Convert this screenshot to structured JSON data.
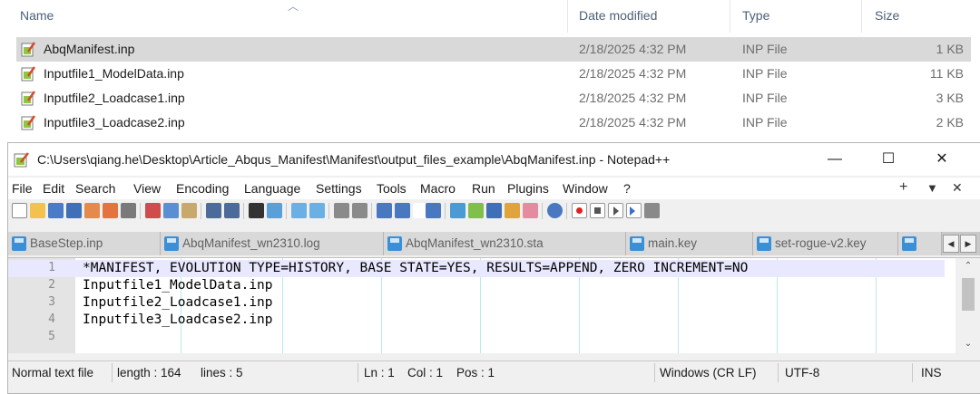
{
  "explorer": {
    "columns": {
      "name": "Name",
      "date": "Date modified",
      "type": "Type",
      "size": "Size"
    },
    "files": [
      {
        "name": "AbqManifest.inp",
        "date": "2/18/2025 4:32 PM",
        "type": "INP File",
        "size": "1 KB",
        "selected": true
      },
      {
        "name": "Inputfile1_ModelData.inp",
        "date": "2/18/2025 4:32 PM",
        "type": "INP File",
        "size": "11 KB",
        "selected": false
      },
      {
        "name": "Inputfile2_Loadcase1.inp",
        "date": "2/18/2025 4:32 PM",
        "type": "INP File",
        "size": "3 KB",
        "selected": false
      },
      {
        "name": "Inputfile3_Loadcase2.inp",
        "date": "2/18/2025 4:32 PM",
        "type": "INP File",
        "size": "2 KB",
        "selected": false
      }
    ]
  },
  "notepad": {
    "title": "C:\\Users\\qiang.he\\Desktop\\Article_Abqus_Manifest\\Manifest\\output_files_example\\AbqManifest.inp - Notepad++",
    "window_buttons": {
      "minimize": "—",
      "maximize": "☐",
      "close": "✕"
    },
    "menu": [
      "File",
      "Edit",
      "Search",
      "View",
      "Encoding",
      "Language",
      "Settings",
      "Tools",
      "Macro",
      "Run",
      "Plugins",
      "Window",
      "?"
    ],
    "menu_right": {
      "plus": "+",
      "down": "▼",
      "close": "✕"
    },
    "tabs": [
      "BaseStep.inp",
      "AbqManifest_wn2310.log",
      "AbqManifest_wn2310.sta",
      "main.key",
      "set-rogue-v2.key"
    ],
    "lines": [
      {
        "num": "1",
        "text": "*MANIFEST, EVOLUTION TYPE=HISTORY, BASE STATE=YES, RESULTS=APPEND, ZERO INCREMENT=NO"
      },
      {
        "num": "2",
        "text": "Inputfile1_ModelData.inp"
      },
      {
        "num": "3",
        "text": "Inputfile2_Loadcase1.inp"
      },
      {
        "num": "4",
        "text": "Inputfile3_Loadcase2.inp"
      },
      {
        "num": "5",
        "text": ""
      }
    ],
    "status": {
      "file_type": "Normal text file",
      "length": "length : 164",
      "lines": "lines : 5",
      "ln": "Ln : 1",
      "col": "Col : 1",
      "pos": "Pos : 1",
      "eol": "Windows (CR LF)",
      "encoding": "UTF-8",
      "mode": "INS"
    }
  },
  "colors": {
    "selection": "#d9d9d9",
    "current_line": "#e8e8ff",
    "tab_disk": "#3a8fd6",
    "indent_guide": "#bde7ee"
  }
}
